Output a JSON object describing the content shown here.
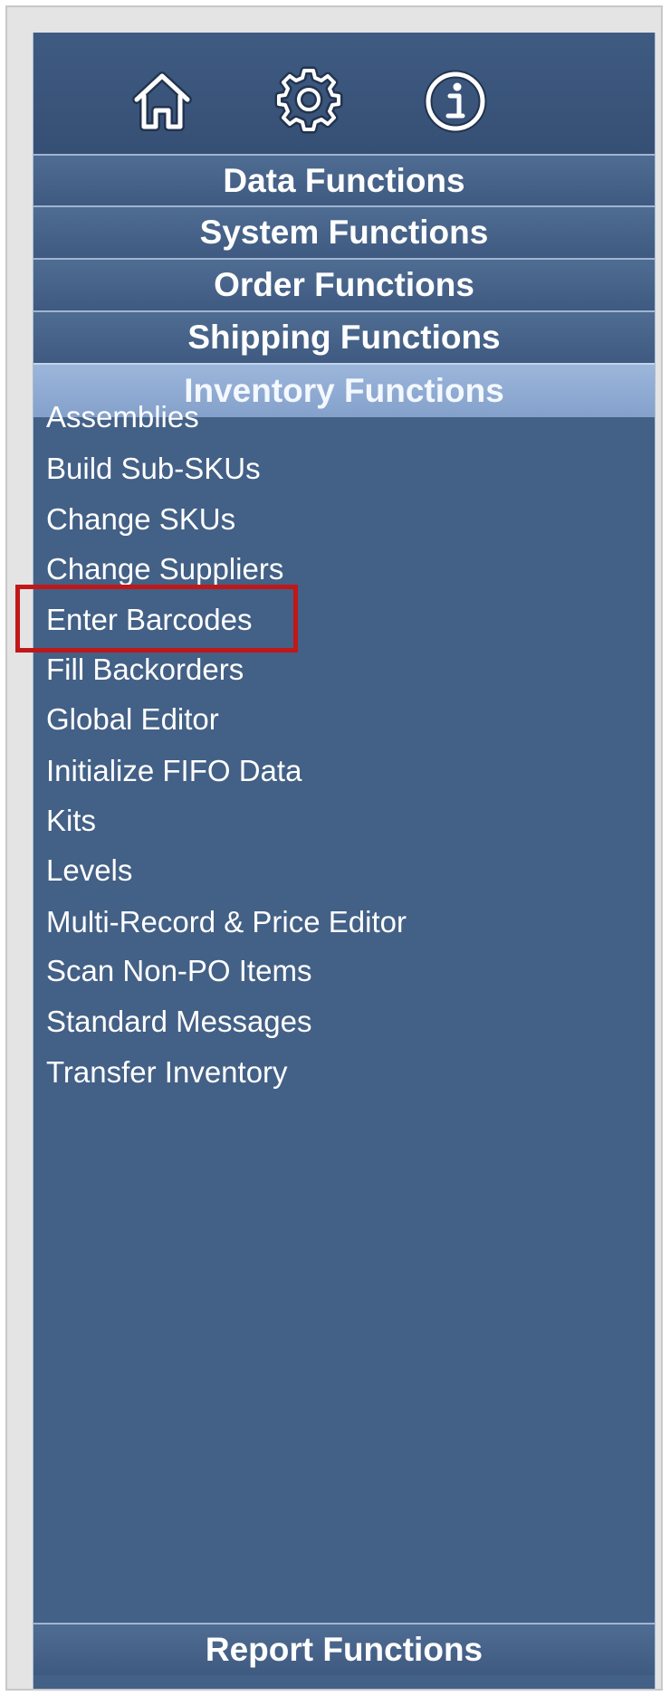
{
  "toolbar": {
    "icons": [
      {
        "name": "home-icon"
      },
      {
        "name": "gear-icon"
      },
      {
        "name": "info-icon"
      }
    ]
  },
  "sections": {
    "data": "Data Functions",
    "system": "System Functions",
    "order": "Order Functions",
    "shipping": "Shipping Functions",
    "inventory": "Inventory Functions",
    "report": "Report Functions"
  },
  "inventory_items": [
    "Assemblies",
    "Build Sub-SKUs",
    "Change SKUs",
    "Change Suppliers",
    "Enter Barcodes",
    "Fill Backorders",
    "Global Editor",
    "Initialize FIFO Data",
    "Kits",
    "Levels",
    "Multi-Record & Price Editor",
    "Scan Non-PO Items",
    "Standard Messages",
    "Transfer Inventory"
  ],
  "colors": {
    "panel": "#436086",
    "active_section": "#8aa6ce",
    "highlight": "#c01818"
  }
}
